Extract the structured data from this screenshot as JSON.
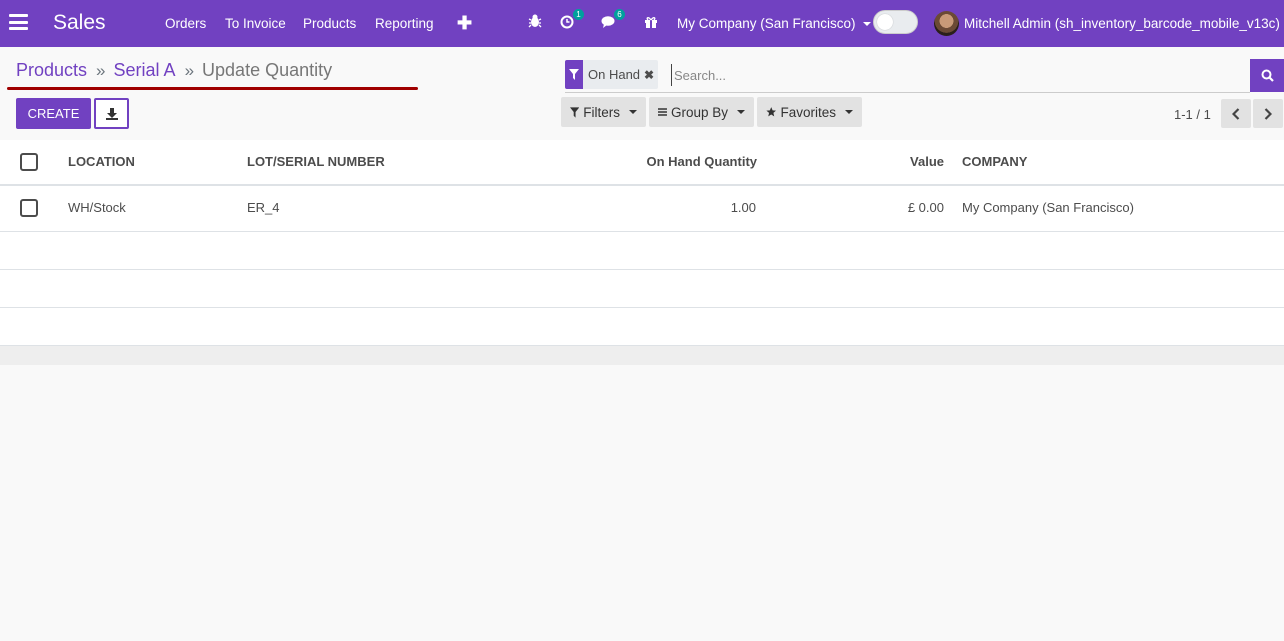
{
  "navbar": {
    "app_name": "Sales",
    "menu": [
      "Orders",
      "To Invoice",
      "Products",
      "Reporting"
    ],
    "activity_count": "1",
    "message_count": "6",
    "company": "My Company (San Francisco)",
    "user": "Mitchell Admin (sh_inventory_barcode_mobile_v13c)"
  },
  "breadcrumb": {
    "items": [
      "Products",
      "Serial A"
    ],
    "current": "Update Quantity"
  },
  "actions": {
    "create_label": "CREATE"
  },
  "search": {
    "facet_label": "On Hand",
    "placeholder": "Search..."
  },
  "filters": {
    "filters_label": "Filters",
    "group_by_label": "Group By",
    "favorites_label": "Favorites"
  },
  "pager": {
    "value": "1-1 / 1"
  },
  "table": {
    "columns": [
      "LOCATION",
      "LOT/SERIAL NUMBER",
      "On Hand Quantity",
      "Value",
      "COMPANY"
    ],
    "rows": [
      [
        "WH/Stock",
        "ER_4",
        "1.00",
        "£ 0.00",
        "My Company (San Francisco)"
      ]
    ]
  },
  "colors": {
    "brand": "#7141c1",
    "highlight_underline": "#a00000"
  }
}
